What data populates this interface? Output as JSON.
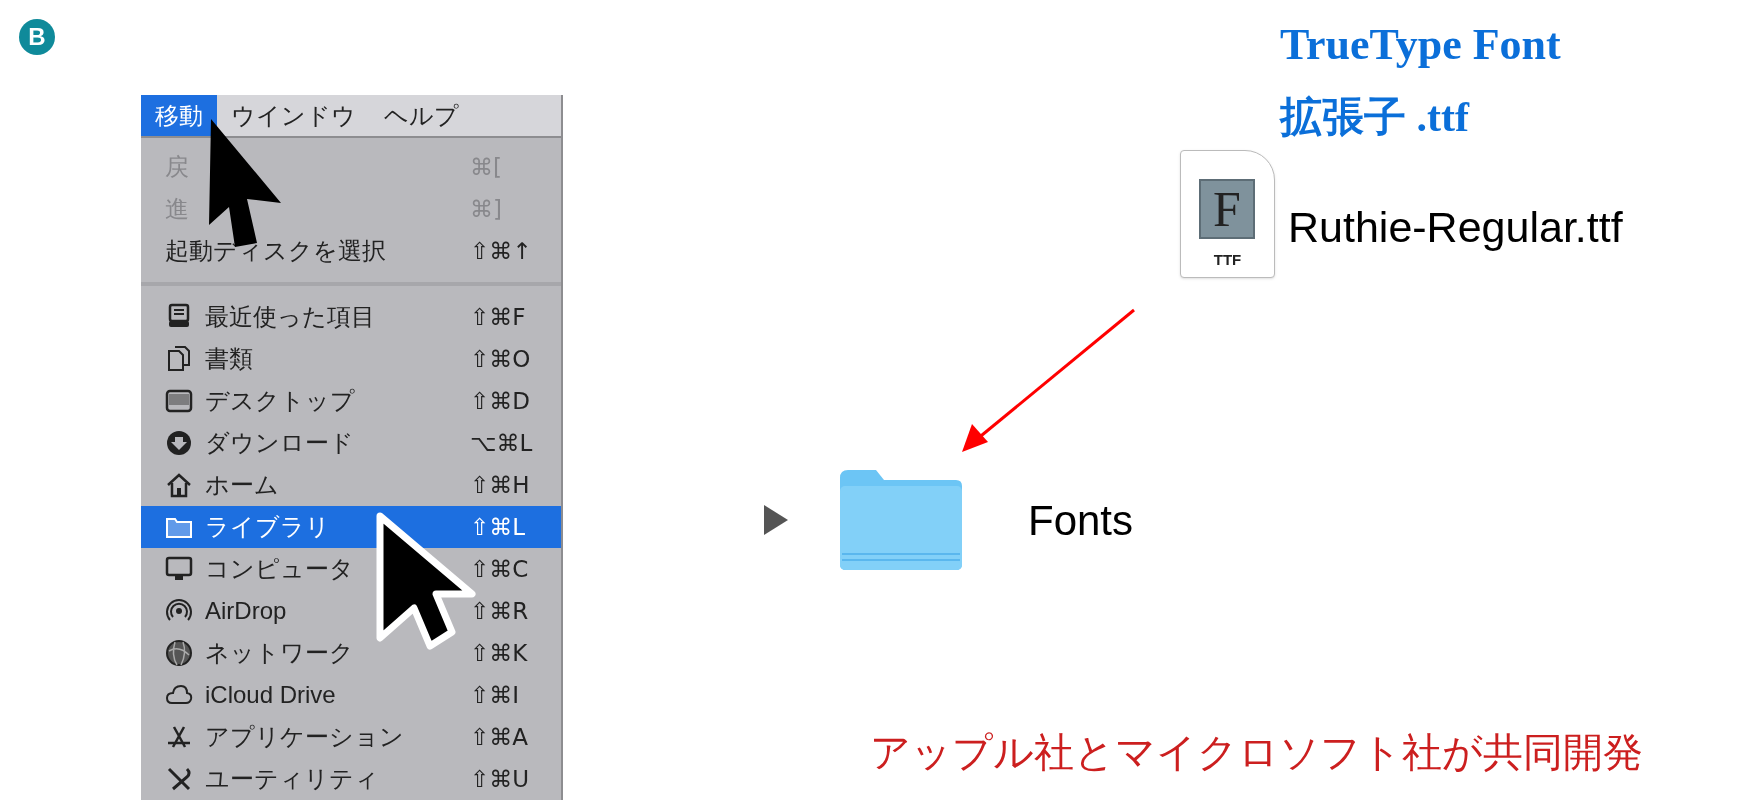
{
  "badge": "B",
  "menu_bar": [
    {
      "label": "移動",
      "selected": true
    },
    {
      "label": "ウインドウ",
      "selected": false
    },
    {
      "label": "ヘルプ",
      "selected": false
    }
  ],
  "menu": {
    "items": [
      {
        "kind": "item",
        "label": "戻",
        "shortcut": "⌘[",
        "disabled": true,
        "selected": false
      },
      {
        "kind": "item",
        "label": "進",
        "shortcut": "⌘]",
        "disabled": true,
        "selected": false
      },
      {
        "kind": "item",
        "label": "起動ディスクを選択",
        "shortcut": "⇧⌘↑",
        "disabled": false,
        "selected": false
      },
      {
        "kind": "separator"
      },
      {
        "kind": "item",
        "label": "最近使った項目",
        "shortcut": "⇧⌘F",
        "disabled": false,
        "selected": false
      },
      {
        "kind": "item",
        "label": "書類",
        "shortcut": "⇧⌘O",
        "disabled": false,
        "selected": false
      },
      {
        "kind": "item",
        "label": "デスクトップ",
        "shortcut": "⇧⌘D",
        "disabled": false,
        "selected": false
      },
      {
        "kind": "item",
        "label": "ダウンロード",
        "shortcut": "⌥⌘L",
        "disabled": false,
        "selected": false
      },
      {
        "kind": "item",
        "label": "ホーム",
        "shortcut": "⇧⌘H",
        "disabled": false,
        "selected": false
      },
      {
        "kind": "item",
        "label": "ライブラリ",
        "shortcut": "⇧⌘L",
        "disabled": false,
        "selected": true
      },
      {
        "kind": "item",
        "label": "コンピュータ",
        "shortcut": "⇧⌘C",
        "disabled": false,
        "selected": false
      },
      {
        "kind": "item",
        "label": "AirDrop",
        "shortcut": "⇧⌘R",
        "disabled": false,
        "selected": false
      },
      {
        "kind": "item",
        "label": "ネットワーク",
        "shortcut": "⇧⌘K",
        "disabled": false,
        "selected": false
      },
      {
        "kind": "item",
        "label": "iCloud Drive",
        "shortcut": "⇧⌘I",
        "disabled": false,
        "selected": false
      },
      {
        "kind": "item",
        "label": "アプリケーション",
        "shortcut": "⇧⌘A",
        "disabled": false,
        "selected": false
      },
      {
        "kind": "item",
        "label": "ユーティリティ",
        "shortcut": "⇧⌘U",
        "disabled": false,
        "selected": false
      }
    ]
  },
  "heading": {
    "title": "TrueType Font",
    "subtitle": "拡張子 .ttf"
  },
  "file": {
    "name": "Ruthie-Regular.ttf",
    "icon_letter": "F",
    "icon_type": "TTF"
  },
  "folder": {
    "name": "Fonts",
    "expanded": false
  },
  "note": "アップル社とマイクロソフト社が共同開発"
}
